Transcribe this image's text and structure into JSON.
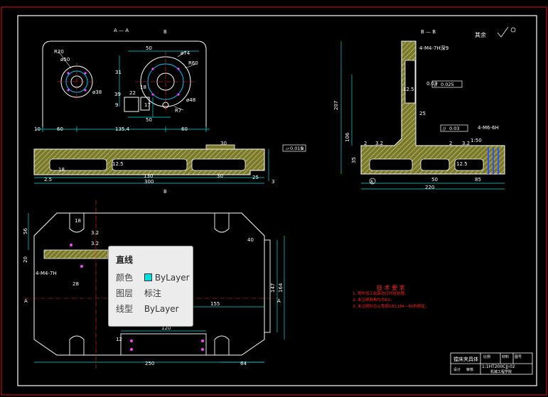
{
  "drawing": {
    "section_aa": "A — A",
    "section_bb": "B — B",
    "label_b": "B",
    "label_a": "A",
    "roughness_note": "其余",
    "dims_top": [
      "R20",
      "50",
      "ø50",
      "ø74",
      "R60",
      "ø38",
      "22",
      "18",
      "ø48",
      "50",
      "R7",
      "39",
      "9",
      "31",
      "17",
      "10",
      "60",
      "135.4",
      "60"
    ],
    "dims_bottom": [
      "12.5",
      "130",
      "30",
      "300",
      "2.5",
      "25",
      "3",
      "18",
      "30"
    ],
    "tol_flat": "0.015",
    "tol_ref_b": "B",
    "side_dims": [
      "207",
      "106",
      "35",
      "25",
      "50",
      "85",
      "220",
      "12.5",
      "4-M4-7H深9",
      "4-M6-6H",
      "0.025",
      "0.03",
      "1:50",
      "12.5",
      "2",
      "2",
      "3.2",
      "3.2"
    ],
    "tol_par": "0.025",
    "tol_par2": "0.03",
    "plan_dims": [
      "18",
      "56",
      "20",
      "40",
      "147",
      "164",
      "155",
      "120",
      "250",
      "64",
      "4-M4-7H",
      "28",
      "3.2",
      "3.2",
      "35",
      "46",
      "12"
    ],
    "tech_title": "技 术 要 求",
    "tech_lines": [
      "1. 零件加工前需进行时效处理。",
      "2. 未注明倒角均为R3。",
      "3. 未注明形位公差按GB1184—80的规定。"
    ],
    "title_block": {
      "name": "镗床夹具体",
      "drawing_no": "1:1HT200CJJ-02",
      "scale_label": "比例",
      "material_label": "材料",
      "qty_label": "图号",
      "designer": "设计",
      "checker": "审核",
      "school": "机械工程学院"
    }
  },
  "tooltip": {
    "title": "直线",
    "color_label": "颜色",
    "color_value": "ByLayer",
    "color_swatch": "#00e0e0",
    "layer_label": "图层",
    "layer_value": "标注",
    "linetype_label": "线型",
    "linetype_value": "ByLayer"
  }
}
